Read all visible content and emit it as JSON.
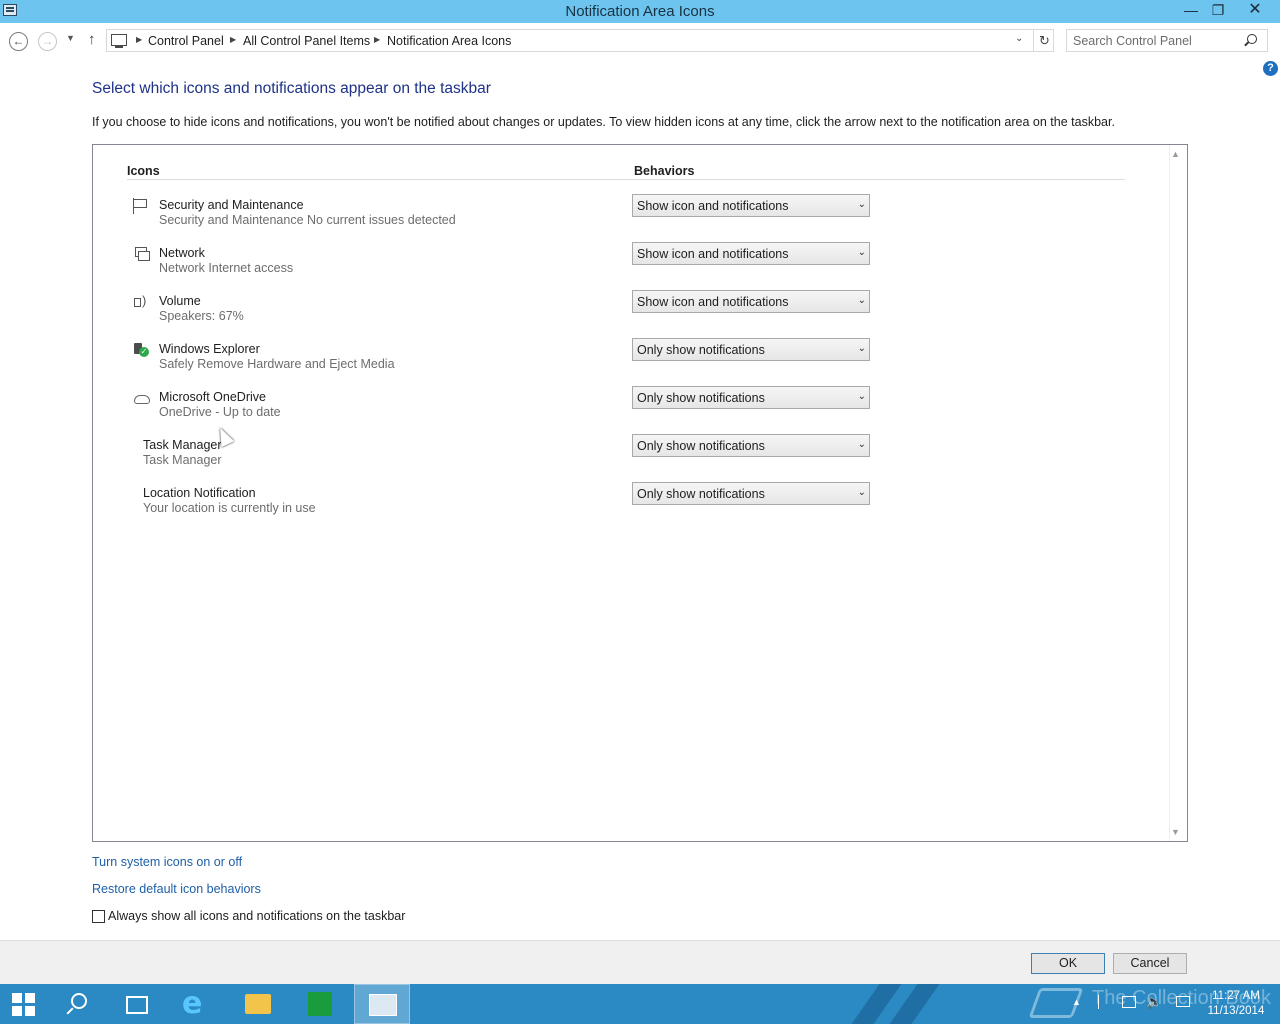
{
  "window": {
    "title": "Notification Area Icons",
    "min_glyph": "—",
    "max_glyph": "❐",
    "close_glyph": "✕"
  },
  "nav": {
    "back_glyph": "←",
    "forward_glyph": "→",
    "recent_glyph": "▼",
    "up_glyph": "↑"
  },
  "address": {
    "breadcrumbs": [
      "Control Panel",
      "All Control Panel Items",
      "Notification Area Icons"
    ],
    "separator_glyph": "▶",
    "dropdown_glyph": "⌄",
    "refresh_glyph": "↻"
  },
  "search": {
    "placeholder": "Search Control Panel"
  },
  "help": {
    "glyph": "?"
  },
  "main": {
    "heading": "Select which icons and notifications appear on the taskbar",
    "description": "If you choose to hide icons and notifications, you won't be notified about changes or updates. To view hidden icons at any time, click the arrow next to the notification area on the taskbar."
  },
  "table": {
    "col_icons": "Icons",
    "col_behaviors": "Behaviors",
    "dropdown_glyph": "⌄",
    "scroll_up_glyph": "▲",
    "scroll_down_glyph": "▼",
    "rows": [
      {
        "name": "Security and Maintenance",
        "sub": "Security and Maintenance  No current issues detected",
        "behavior": "Show icon and notifications",
        "icon": "flag-icon"
      },
      {
        "name": "Network",
        "sub": "Network Internet access",
        "behavior": "Show icon and notifications",
        "icon": "network-icon"
      },
      {
        "name": "Volume",
        "sub": "Speakers: 67%",
        "behavior": "Show icon and notifications",
        "icon": "speaker-icon"
      },
      {
        "name": "Windows Explorer",
        "sub": "Safely Remove Hardware and Eject Media",
        "behavior": "Only show notifications",
        "icon": "usb-eject-icon"
      },
      {
        "name": "Microsoft OneDrive",
        "sub": "OneDrive - Up to date",
        "behavior": "Only show notifications",
        "icon": "cloud-icon"
      },
      {
        "name": "Task Manager",
        "sub": "Task Manager",
        "behavior": "Only show notifications",
        "icon": ""
      },
      {
        "name": "Location Notification",
        "sub": "Your location is currently in use",
        "behavior": "Only show notifications",
        "icon": ""
      }
    ]
  },
  "links": {
    "system_icons": "Turn system icons on or off",
    "restore_defaults": "Restore default icon behaviors",
    "always_show_label": "Always show all icons and notifications on the taskbar"
  },
  "buttons": {
    "ok": "OK",
    "cancel": "Cancel"
  },
  "taskbar": {
    "tray_up_glyph": "▲",
    "volume_glyph": "🔈",
    "time": "11:27 AM",
    "date": "11/13/2014",
    "watermark": "The Collection Book"
  },
  "colors": {
    "titlebar": "#6cc4ef",
    "heading": "#1e3287",
    "link": "#1e5fa8",
    "taskbar": "#2b8ac4"
  }
}
